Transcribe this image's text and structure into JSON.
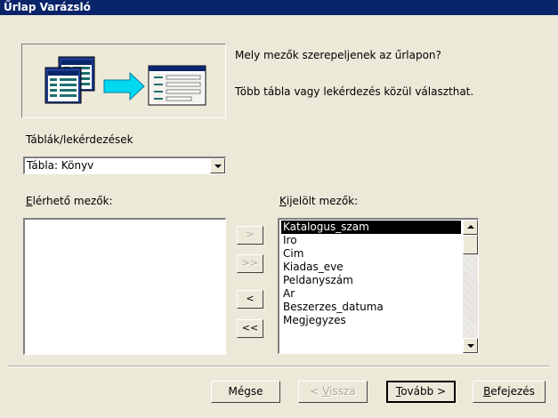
{
  "window": {
    "title": "Űrlap Varázsló"
  },
  "intro": {
    "question": "Mely mezők szerepeljenek az űrlapon?",
    "hint": "Több tábla vagy lekérdezés közül választhat."
  },
  "source": {
    "label": "Táblák/lekérdezések",
    "selected": "Tábla: Könyv"
  },
  "available": {
    "label_accel": "E",
    "label_rest": "lérhető mezők:",
    "items": []
  },
  "selected_fields": {
    "label_accel": "K",
    "label_rest": "ijelölt mezők:",
    "items": [
      "Katalogus_szam",
      "Iro",
      "Cim",
      "Kiadas_eve",
      "Peldanyszám",
      "Ar",
      "Beszerzes_datuma",
      "Megjegyzes"
    ],
    "highlighted": "Katalogus_szam"
  },
  "move_buttons": {
    "add_one": ">",
    "add_all": ">>",
    "remove_one": "<",
    "remove_all": "<<"
  },
  "buttons": {
    "cancel": "Mégse",
    "back_prefix": "< ",
    "back_accel": "V",
    "back_rest": "issza",
    "next_accel": "T",
    "next_rest": "ovább >",
    "finish_accel": "B",
    "finish_rest": "efejezés"
  }
}
